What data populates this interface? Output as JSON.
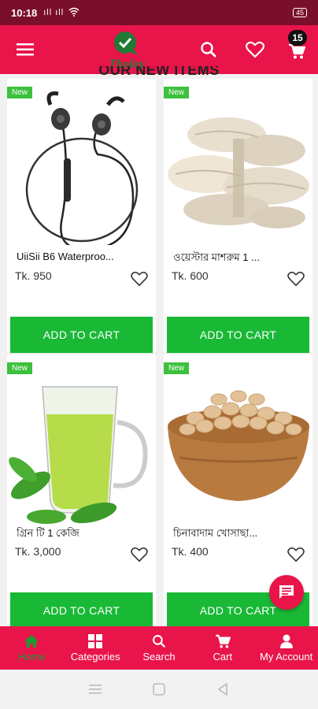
{
  "status_bar": {
    "time": "10:18",
    "signal": "ıll ıll",
    "battery": "45"
  },
  "app_bar": {
    "logo_text": "Tholay",
    "cart_count": "15"
  },
  "section": {
    "title": "OUR NEW ITEMS"
  },
  "products": [
    {
      "badge": "New",
      "name": "UiiSii B6 Waterproo...",
      "price": "Tk. 950",
      "button": "ADD TO CART"
    },
    {
      "badge": "New",
      "name": "ওয়েস্টার মাশরুম 1 ...",
      "price": "Tk. 600",
      "button": "ADD TO CART"
    },
    {
      "badge": "New",
      "name": "গ্রিন টি 1 কেজি",
      "price": "Tk. 3,000",
      "button": "ADD TO CART"
    },
    {
      "badge": "New",
      "name": "চিনাবাদাম খোসাছা...",
      "price": "Tk. 400",
      "button": "ADD TO CART"
    }
  ],
  "bottom_nav": [
    {
      "label": "Home",
      "icon": "home-icon",
      "active": true
    },
    {
      "label": "Categories",
      "icon": "grid-icon"
    },
    {
      "label": "Search",
      "icon": "search-icon"
    },
    {
      "label": "Cart",
      "icon": "cart-icon"
    },
    {
      "label": "My Account",
      "icon": "person-icon"
    }
  ],
  "colors": {
    "primary": "#e8144a",
    "green": "#19b936",
    "active_nav": "#1b9a33",
    "status": "#7a0f2b"
  }
}
